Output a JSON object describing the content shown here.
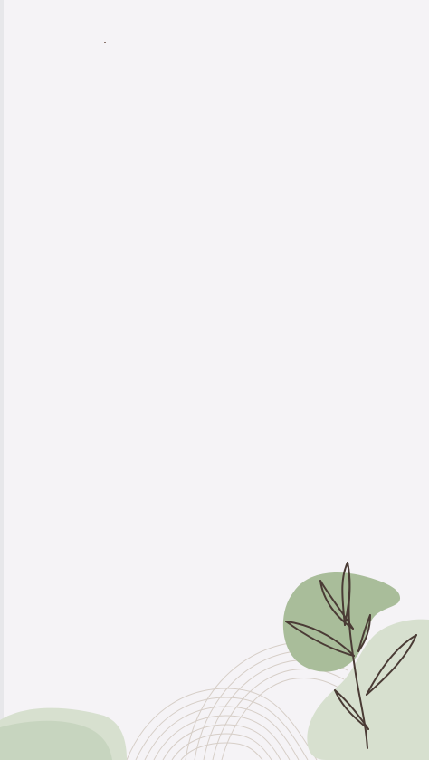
{
  "artwork": {
    "theme": "minimal botanical background",
    "colors": {
      "background": "#f5f3f6",
      "sage_light": "#d7e0cf",
      "sage_medium": "#a9bd9a",
      "sage_soft": "#c7d5bf",
      "stem": "#4a3b35",
      "lines": "#d6cec7"
    },
    "icons": [
      "leaf-branch-icon",
      "blob-shape",
      "wave-lines"
    ]
  }
}
